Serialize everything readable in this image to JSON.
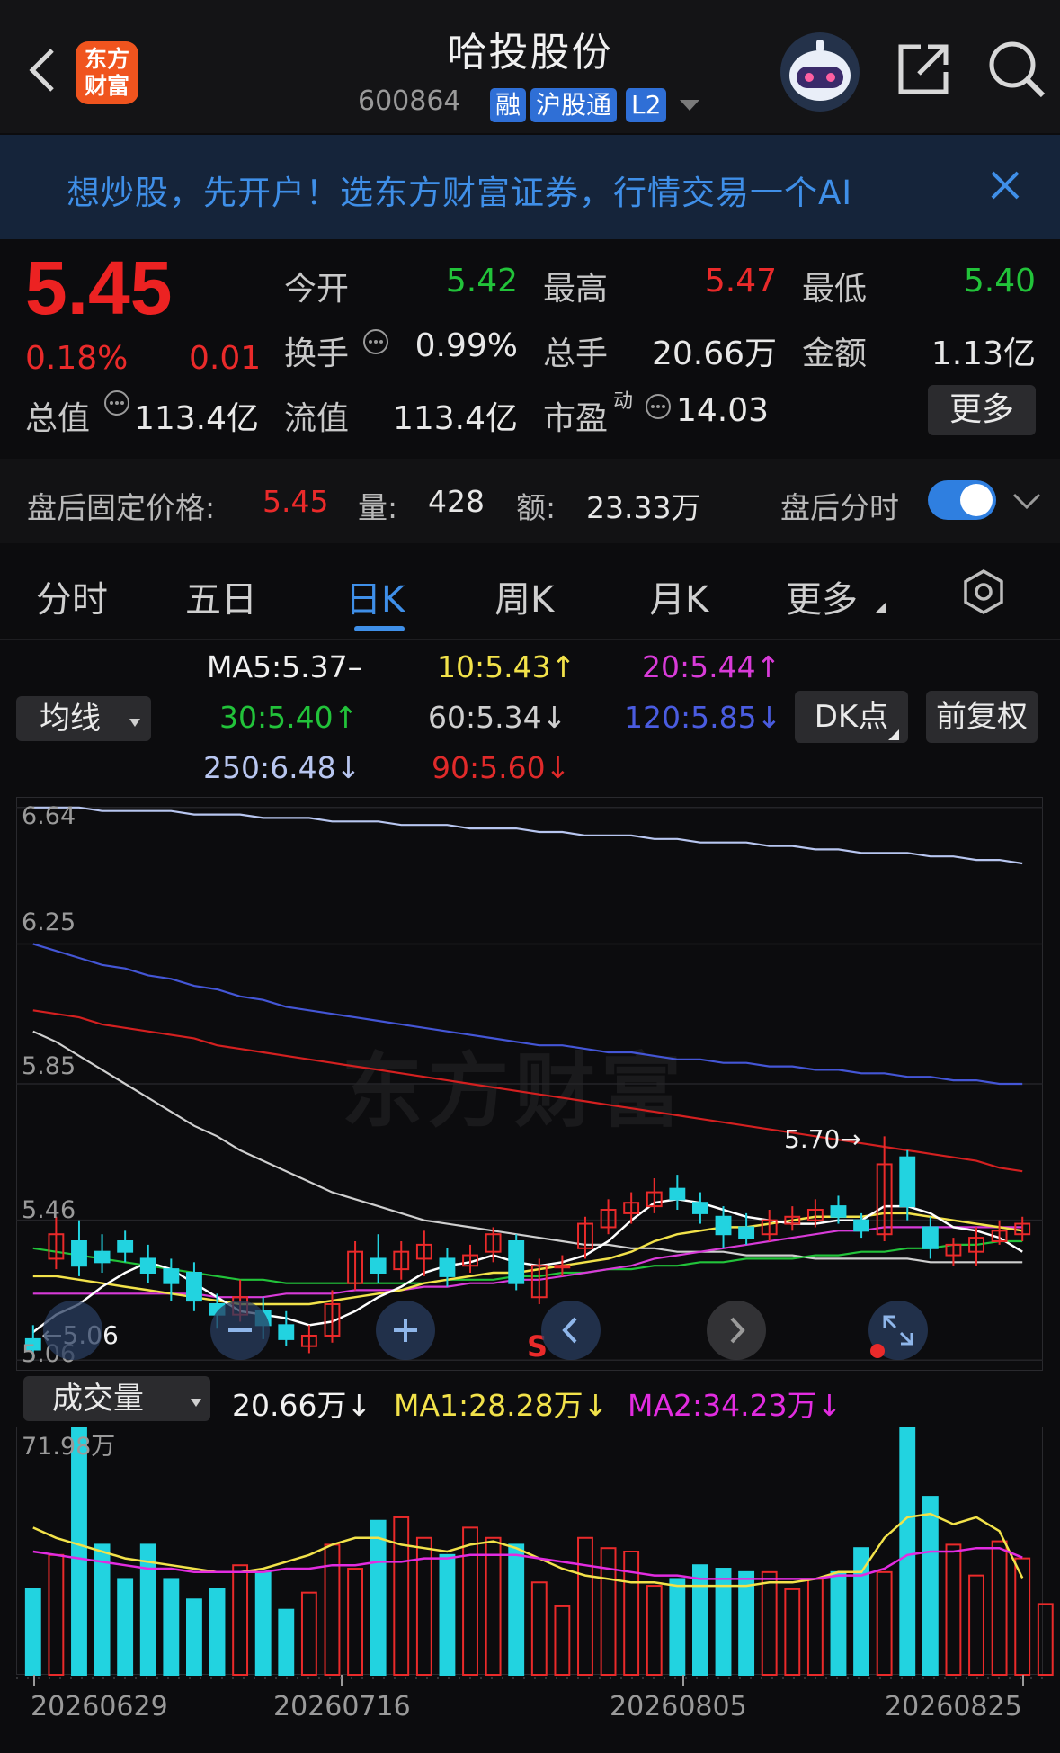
{
  "header": {
    "title": "哈投股份",
    "code": "600864",
    "tags": [
      "融",
      "沪股通",
      "L2"
    ],
    "logo_lines": [
      "东方",
      "财富"
    ]
  },
  "banner": {
    "text": "想炒股，先开户！选东方财富证券，行情交易一个AI"
  },
  "quote": {
    "price": "5.45",
    "change_pct": "0.18%",
    "change": "0.01",
    "open_label": "今开",
    "open": "5.42",
    "high_label": "最高",
    "high": "5.47",
    "low_label": "最低",
    "low": "5.40",
    "turnover_label": "换手",
    "turnover": "0.99%",
    "volume_label": "总手",
    "volume": "20.66万",
    "amount_label": "金额",
    "amount": "1.13亿",
    "mktcap_label": "总值",
    "mktcap": "113.4亿",
    "float_label": "流值",
    "float": "113.4亿",
    "pe_label": "市盈",
    "pe_sup": "动",
    "pe": "14.03",
    "more": "更多"
  },
  "after_hours": {
    "price_label": "盘后固定价格:",
    "price": "5.45",
    "vol_label": "量:",
    "vol": "428",
    "amt_label": "额:",
    "amt": "23.33万",
    "toggle_label": "盘后分时"
  },
  "tabs": [
    "分时",
    "五日",
    "日K",
    "周K",
    "月K",
    "更多"
  ],
  "ma": {
    "selector": "均线",
    "ma5": "MA5:5.37–",
    "ma10": "10:5.43↑",
    "ma20": "20:5.44↑",
    "ma30": "30:5.40↑",
    "ma60": "60:5.34↓",
    "ma120": "120:5.85↓",
    "ma250": "250:6.48↓",
    "ma90": "90:5.60↓",
    "dk_button": "DK点",
    "adjust_button": "前复权"
  },
  "kline": {
    "y_ticks": [
      "6.64",
      "6.25",
      "5.85",
      "5.46",
      "5.06"
    ],
    "high_marker": "5.70→",
    "low_marker": "←5.06",
    "watermark": "东方财富",
    "sell_marker": "S"
  },
  "volume": {
    "selector": "成交量",
    "current": "20.66万↓",
    "ma1": "MA1:28.28万↓",
    "ma2": "MA2:34.23万↓",
    "max_tick": "71.98万",
    "dates": [
      "20260629",
      "20260716",
      "20260805",
      "20260825"
    ]
  },
  "colors": {
    "up": "#ea2a2a",
    "down": "#22d3e0",
    "ma5": "#ffffff",
    "ma10": "#f2e24a",
    "ma20": "#d83bd8",
    "ma30": "#22c33a",
    "ma60": "#cfcfcf",
    "ma120": "#4456d6",
    "ma250": "#b8c6f0",
    "ma90": "#d42020",
    "accent": "#2f8fe8"
  },
  "chart_data": {
    "type": "candlestick",
    "candles": [
      {
        "o": 5.12,
        "c": 5.09,
        "h": 5.16,
        "l": 5.06
      },
      {
        "o": 5.35,
        "c": 5.42,
        "h": 5.47,
        "l": 5.32
      },
      {
        "o": 5.4,
        "c": 5.33,
        "h": 5.46,
        "l": 5.3
      },
      {
        "o": 5.37,
        "c": 5.34,
        "h": 5.42,
        "l": 5.31
      },
      {
        "o": 5.4,
        "c": 5.37,
        "h": 5.43,
        "l": 5.34
      },
      {
        "o": 5.35,
        "c": 5.31,
        "h": 5.39,
        "l": 5.28
      },
      {
        "o": 5.32,
        "c": 5.28,
        "h": 5.35,
        "l": 5.23
      },
      {
        "o": 5.31,
        "c": 5.23,
        "h": 5.34,
        "l": 5.2
      },
      {
        "o": 5.22,
        "c": 5.19,
        "h": 5.25,
        "l": 5.15
      },
      {
        "o": 5.19,
        "c": 5.24,
        "h": 5.29,
        "l": 5.17
      },
      {
        "o": 5.2,
        "c": 5.16,
        "h": 5.24,
        "l": 5.12
      },
      {
        "o": 5.16,
        "c": 5.12,
        "h": 5.2,
        "l": 5.1
      },
      {
        "o": 5.1,
        "c": 5.13,
        "h": 5.16,
        "l": 5.08
      },
      {
        "o": 5.13,
        "c": 5.22,
        "h": 5.26,
        "l": 5.11
      },
      {
        "o": 5.28,
        "c": 5.37,
        "h": 5.4,
        "l": 5.26
      },
      {
        "o": 5.35,
        "c": 5.31,
        "h": 5.42,
        "l": 5.28
      },
      {
        "o": 5.32,
        "c": 5.37,
        "h": 5.4,
        "l": 5.29
      },
      {
        "o": 5.35,
        "c": 5.39,
        "h": 5.43,
        "l": 5.3
      },
      {
        "o": 5.35,
        "c": 5.3,
        "h": 5.38,
        "l": 5.27
      },
      {
        "o": 5.33,
        "c": 5.36,
        "h": 5.39,
        "l": 5.31
      },
      {
        "o": 5.37,
        "c": 5.42,
        "h": 5.44,
        "l": 5.34
      },
      {
        "o": 5.4,
        "c": 5.28,
        "h": 5.42,
        "l": 5.26
      },
      {
        "o": 5.24,
        "c": 5.33,
        "h": 5.35,
        "l": 5.22
      },
      {
        "o": 5.33,
        "c": 5.33,
        "h": 5.36,
        "l": 5.3
      },
      {
        "o": 5.38,
        "c": 5.45,
        "h": 5.47,
        "l": 5.35
      },
      {
        "o": 5.44,
        "c": 5.49,
        "h": 5.52,
        "l": 5.42
      },
      {
        "o": 5.48,
        "c": 5.51,
        "h": 5.54,
        "l": 5.45
      },
      {
        "o": 5.5,
        "c": 5.54,
        "h": 5.58,
        "l": 5.48
      },
      {
        "o": 5.55,
        "c": 5.52,
        "h": 5.59,
        "l": 5.49
      },
      {
        "o": 5.51,
        "c": 5.48,
        "h": 5.54,
        "l": 5.45
      },
      {
        "o": 5.47,
        "c": 5.42,
        "h": 5.5,
        "l": 5.38
      },
      {
        "o": 5.44,
        "c": 5.41,
        "h": 5.48,
        "l": 5.39
      },
      {
        "o": 5.42,
        "c": 5.46,
        "h": 5.49,
        "l": 5.4
      },
      {
        "o": 5.45,
        "c": 5.47,
        "h": 5.5,
        "l": 5.43
      },
      {
        "o": 5.46,
        "c": 5.49,
        "h": 5.52,
        "l": 5.44
      },
      {
        "o": 5.5,
        "c": 5.47,
        "h": 5.53,
        "l": 5.45
      },
      {
        "o": 5.46,
        "c": 5.43,
        "h": 5.48,
        "l": 5.41
      },
      {
        "o": 5.42,
        "c": 5.62,
        "h": 5.7,
        "l": 5.4
      },
      {
        "o": 5.64,
        "c": 5.5,
        "h": 5.66,
        "l": 5.46
      },
      {
        "o": 5.44,
        "c": 5.38,
        "h": 5.47,
        "l": 5.35
      },
      {
        "o": 5.36,
        "c": 5.39,
        "h": 5.41,
        "l": 5.33
      },
      {
        "o": 5.37,
        "c": 5.41,
        "h": 5.44,
        "l": 5.33
      },
      {
        "o": 5.4,
        "c": 5.43,
        "h": 5.46,
        "l": 5.39
      },
      {
        "o": 5.42,
        "c": 5.45,
        "h": 5.47,
        "l": 5.4
      }
    ],
    "ma_series": {
      "ma5": [
        5.14,
        5.19,
        5.22,
        5.27,
        5.31,
        5.34,
        5.32,
        5.28,
        5.24,
        5.2,
        5.19,
        5.18,
        5.16,
        5.17,
        5.2,
        5.24,
        5.27,
        5.31,
        5.33,
        5.34,
        5.36,
        5.34,
        5.33,
        5.34,
        5.36,
        5.4,
        5.46,
        5.51,
        5.52,
        5.51,
        5.49,
        5.47,
        5.46,
        5.45,
        5.45,
        5.46,
        5.46,
        5.5,
        5.5,
        5.48,
        5.44,
        5.43,
        5.41,
        5.37
      ],
      "ma10": [
        5.3,
        5.3,
        5.29,
        5.28,
        5.27,
        5.26,
        5.25,
        5.24,
        5.23,
        5.22,
        5.22,
        5.22,
        5.22,
        5.23,
        5.24,
        5.25,
        5.26,
        5.28,
        5.29,
        5.3,
        5.31,
        5.31,
        5.32,
        5.33,
        5.34,
        5.35,
        5.37,
        5.4,
        5.42,
        5.43,
        5.44,
        5.44,
        5.45,
        5.46,
        5.47,
        5.47,
        5.47,
        5.48,
        5.48,
        5.47,
        5.46,
        5.45,
        5.44,
        5.43
      ],
      "ma20": [
        5.25,
        5.25,
        5.25,
        5.25,
        5.25,
        5.25,
        5.25,
        5.25,
        5.24,
        5.24,
        5.24,
        5.25,
        5.25,
        5.25,
        5.26,
        5.26,
        5.26,
        5.27,
        5.27,
        5.28,
        5.28,
        5.29,
        5.29,
        5.3,
        5.31,
        5.32,
        5.33,
        5.35,
        5.36,
        5.37,
        5.38,
        5.39,
        5.4,
        5.41,
        5.42,
        5.43,
        5.43,
        5.44,
        5.44,
        5.44,
        5.44,
        5.44,
        5.44,
        5.44
      ],
      "ma30": [
        5.38,
        5.37,
        5.36,
        5.35,
        5.34,
        5.33,
        5.32,
        5.31,
        5.3,
        5.29,
        5.29,
        5.28,
        5.28,
        5.28,
        5.28,
        5.28,
        5.28,
        5.28,
        5.29,
        5.29,
        5.29,
        5.3,
        5.3,
        5.31,
        5.31,
        5.32,
        5.32,
        5.33,
        5.33,
        5.34,
        5.34,
        5.35,
        5.35,
        5.35,
        5.36,
        5.36,
        5.37,
        5.37,
        5.38,
        5.38,
        5.39,
        5.39,
        5.4,
        5.4
      ],
      "ma60": [
        6.0,
        5.97,
        5.93,
        5.89,
        5.85,
        5.81,
        5.77,
        5.73,
        5.7,
        5.66,
        5.63,
        5.6,
        5.57,
        5.54,
        5.52,
        5.5,
        5.48,
        5.46,
        5.45,
        5.44,
        5.43,
        5.42,
        5.41,
        5.4,
        5.39,
        5.39,
        5.38,
        5.38,
        5.37,
        5.37,
        5.37,
        5.36,
        5.36,
        5.36,
        5.35,
        5.35,
        5.35,
        5.35,
        5.35,
        5.34,
        5.34,
        5.34,
        5.34,
        5.34
      ],
      "ma90": [
        6.06,
        6.05,
        6.04,
        6.02,
        6.01,
        6.0,
        5.99,
        5.98,
        5.96,
        5.95,
        5.94,
        5.93,
        5.92,
        5.91,
        5.9,
        5.89,
        5.88,
        5.87,
        5.86,
        5.85,
        5.84,
        5.83,
        5.82,
        5.81,
        5.8,
        5.79,
        5.78,
        5.77,
        5.76,
        5.75,
        5.74,
        5.73,
        5.72,
        5.71,
        5.7,
        5.69,
        5.68,
        5.67,
        5.66,
        5.65,
        5.64,
        5.63,
        5.61,
        5.6
      ],
      "ma120": [
        6.25,
        6.23,
        6.21,
        6.19,
        6.18,
        6.16,
        6.15,
        6.13,
        6.12,
        6.1,
        6.09,
        6.07,
        6.06,
        6.05,
        6.04,
        6.03,
        6.02,
        6.01,
        6.0,
        5.99,
        5.98,
        5.97,
        5.96,
        5.96,
        5.95,
        5.94,
        5.94,
        5.93,
        5.92,
        5.92,
        5.91,
        5.91,
        5.9,
        5.9,
        5.89,
        5.89,
        5.88,
        5.88,
        5.87,
        5.87,
        5.86,
        5.86,
        5.85,
        5.85
      ],
      "ma250": [
        6.64,
        6.64,
        6.64,
        6.63,
        6.63,
        6.63,
        6.63,
        6.62,
        6.62,
        6.62,
        6.61,
        6.61,
        6.61,
        6.6,
        6.6,
        6.6,
        6.59,
        6.59,
        6.59,
        6.58,
        6.58,
        6.58,
        6.57,
        6.57,
        6.56,
        6.56,
        6.56,
        6.55,
        6.55,
        6.54,
        6.54,
        6.54,
        6.53,
        6.53,
        6.52,
        6.52,
        6.51,
        6.51,
        6.51,
        6.5,
        6.5,
        6.49,
        6.49,
        6.48
      ]
    },
    "volume": [
      25,
      35,
      72,
      38,
      28,
      38,
      28,
      22,
      25,
      32,
      30,
      19,
      24,
      38,
      31,
      45,
      46,
      40,
      35,
      43,
      40,
      38,
      27,
      20,
      40,
      37,
      36,
      26,
      28,
      32,
      31,
      30,
      30,
      25,
      28,
      30,
      37,
      30,
      72,
      52,
      38,
      29,
      39,
      34,
      20.66
    ],
    "volume_ma1": [
      43,
      40,
      38,
      36,
      34,
      33,
      32,
      31,
      30,
      30,
      31,
      33,
      35,
      38,
      40,
      40,
      38,
      37,
      36,
      38,
      39,
      37,
      34,
      31,
      29,
      28,
      27,
      27,
      26,
      26,
      26,
      26,
      27,
      27,
      28,
      30,
      30,
      40,
      46,
      47,
      44,
      46,
      42,
      28.28
    ],
    "volume_ma2": [
      36,
      35,
      34,
      33,
      32,
      31,
      31,
      30,
      30,
      30,
      30,
      31,
      31,
      32,
      32,
      33,
      33,
      34,
      34,
      35,
      35,
      35,
      34,
      33,
      32,
      31,
      30,
      29,
      29,
      28,
      28,
      28,
      28,
      28,
      28,
      29,
      29,
      31,
      35,
      36,
      36,
      37,
      37,
      34.23
    ]
  }
}
